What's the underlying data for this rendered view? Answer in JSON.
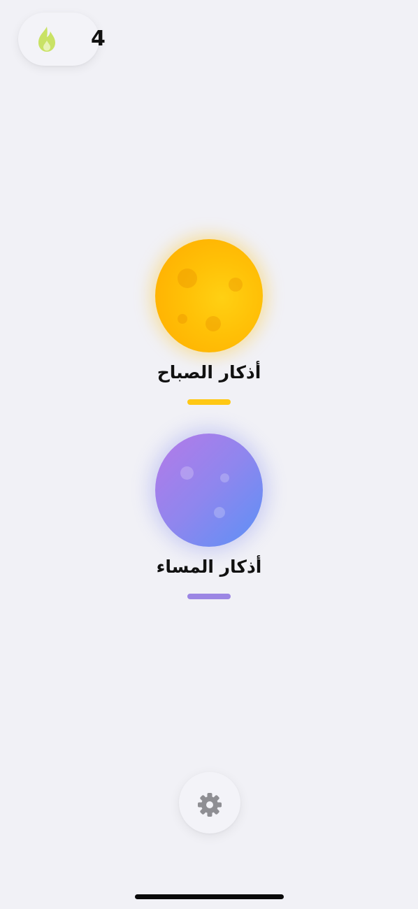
{
  "streak": {
    "count": "4",
    "icon": "flame-icon",
    "icon_color": "#c9e265"
  },
  "cards": {
    "morning": {
      "title": "أذكار الصباح",
      "icon": "sun-icon",
      "accent_color": "#ffc107"
    },
    "evening": {
      "title": "أذكار المساء",
      "icon": "moon-icon",
      "accent_color": "#9b86e6"
    }
  },
  "settings": {
    "icon": "gear-icon",
    "icon_color": "#8e8e93"
  }
}
